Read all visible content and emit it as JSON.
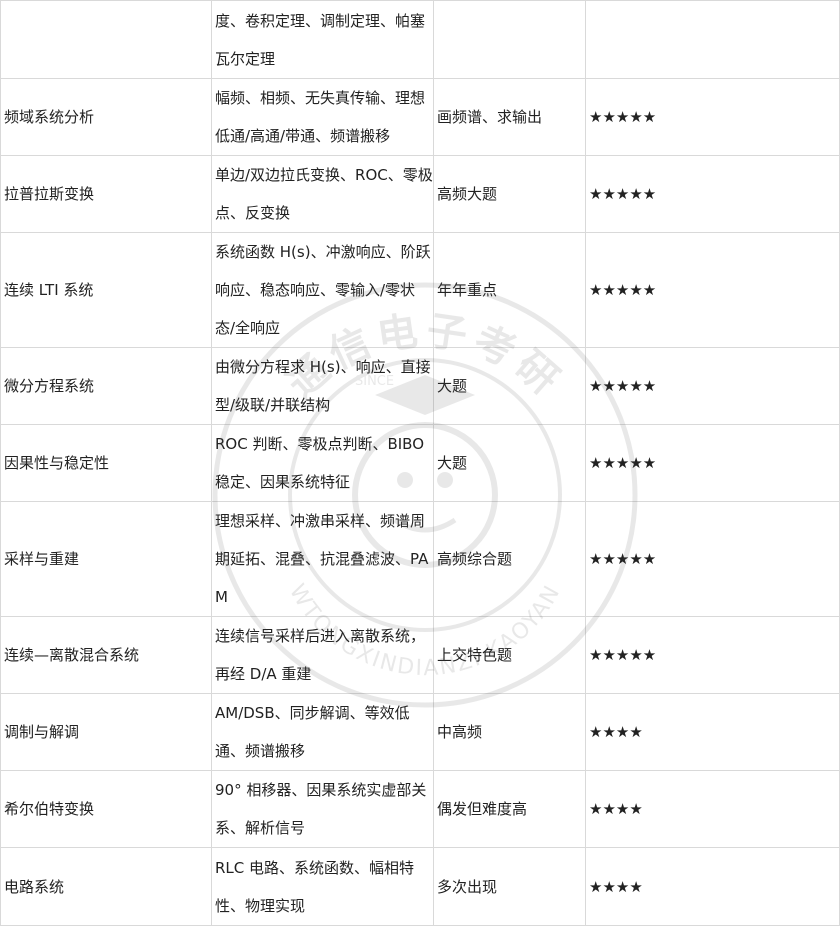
{
  "table": {
    "rows": [
      {
        "topic": "",
        "content": "度、卷积定理、调制定理、帕塞瓦尔定理",
        "note": "",
        "stars": ""
      },
      {
        "topic": "频域系统分析",
        "content": "幅频、相频、无失真传输、理想低通/高通/带通、频谱搬移",
        "note": "画频谱、求输出",
        "stars": "★★★★★"
      },
      {
        "topic": "拉普拉斯变换",
        "content": "单边/双边拉氏变换、ROC、零极点、反变换",
        "note": "高频大题",
        "stars": "★★★★★"
      },
      {
        "topic": "连续 LTI 系统",
        "content": "系统函数 H(s)、冲激响应、阶跃响应、稳态响应、零输入/零状态/全响应",
        "note": "年年重点",
        "stars": "★★★★★"
      },
      {
        "topic": "微分方程系统",
        "content": "由微分方程求 H(s)、响应、直接型/级联/并联结构",
        "note": "大题",
        "stars": "★★★★★"
      },
      {
        "topic": "因果性与稳定性",
        "content": "ROC 判断、零极点判断、BIBO 稳定、因果系统特征",
        "note": "大题",
        "stars": "★★★★★"
      },
      {
        "topic": "采样与重建",
        "content": "理想采样、冲激串采样、频谱周期延拓、混叠、抗混叠滤波、PAM",
        "note": "高频综合题",
        "stars": "★★★★★"
      },
      {
        "topic": "连续—离散混合系统",
        "content": "连续信号采样后进入离散系统，再经 D/A 重建",
        "note": "上交特色题",
        "stars": "★★★★★"
      },
      {
        "topic": "调制与解调",
        "content": "AM/DSB、同步解调、等效低通、频谱搬移",
        "note": "中高频",
        "stars": "★★★★"
      },
      {
        "topic": "希尔伯特变换",
        "content": "90° 相移器、因果系统实虚部关系、解析信号",
        "note": "偶发但难度高",
        "stars": "★★★★"
      },
      {
        "topic": "电路系统",
        "content": "RLC 电路、系统函数、幅相特性、物理实现",
        "note": "多次出现",
        "stars": "★★★★"
      }
    ]
  },
  "watermark": {
    "top_text": "通信电子考研",
    "since_text": "SINCE",
    "bottom_text": "WTONGXINDIANZI KAOYAN",
    "color": "#555555"
  }
}
